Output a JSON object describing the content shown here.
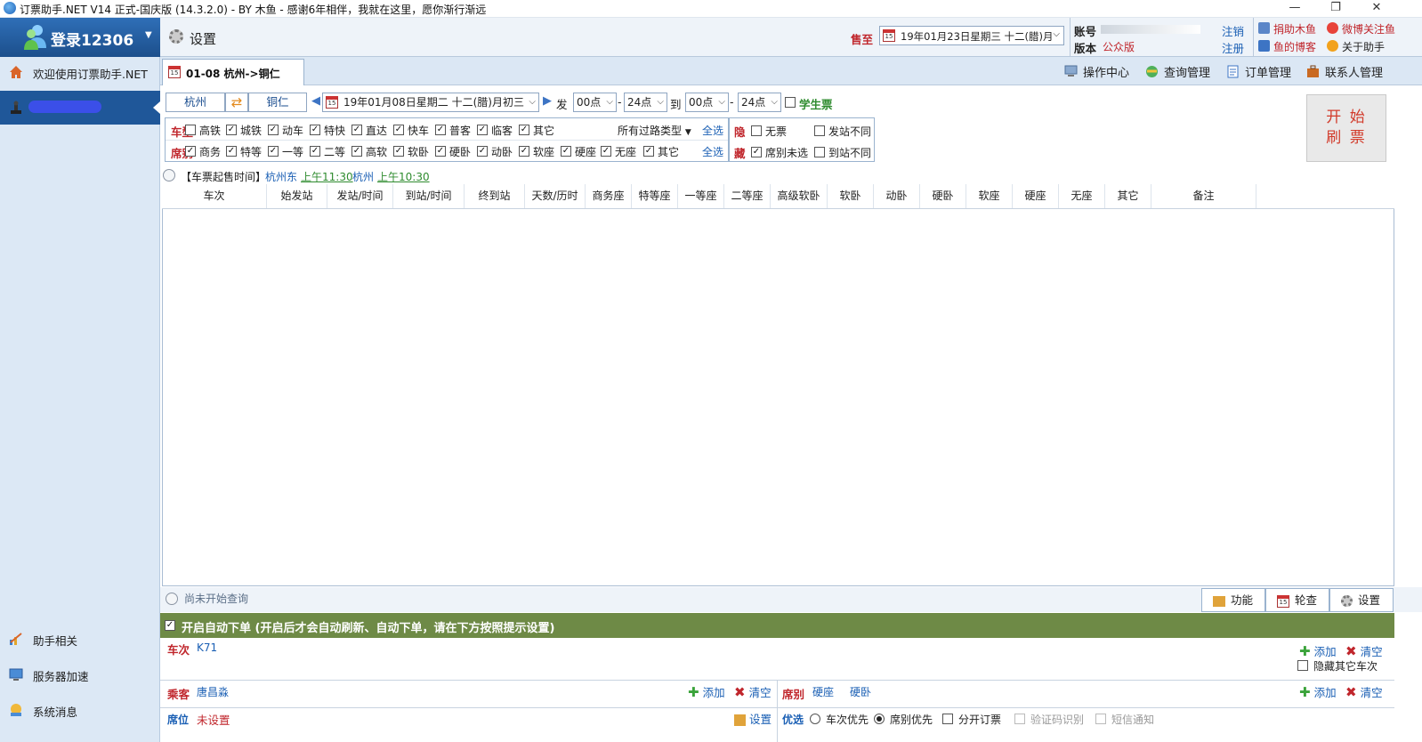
{
  "window": {
    "title": "订票助手.NET V14 正式-国庆版 (14.3.2.0) - BY 木鱼 - 感谢6年相伴，我就在这里，愿你渐行渐远",
    "minimize": "—",
    "restore": "❐",
    "close": "✕"
  },
  "sidebar": {
    "login_label": "登录12306",
    "items": [
      {
        "label": "欢迎使用订票助手.NET",
        "icon": "home-icon"
      },
      {
        "label": "助手相关",
        "icon": "chart-icon"
      },
      {
        "label": "服务器加速",
        "icon": "monitor-icon"
      },
      {
        "label": "系统消息",
        "icon": "message-icon"
      }
    ]
  },
  "toolbar": {
    "settings_label": "设置",
    "sale_label": "售至",
    "sale_date": "19年01月23日星期三 十二(腊)月",
    "account_label": "账号",
    "edition_label": "版本",
    "edition_value": "公众版",
    "logout": "注销",
    "register": "注册",
    "links": [
      "捐助木鱼",
      "微博关注鱼",
      "鱼的博客",
      "关于助手"
    ]
  },
  "tabs": {
    "active_tab": "01-08  杭州->铜仁",
    "menu": [
      "操作中心",
      "查询管理",
      "订单管理",
      "联系人管理"
    ]
  },
  "query": {
    "from": "杭州",
    "to": "铜仁",
    "date": "19年01月08日星期二 十二(腊)月初三",
    "depart_label": "发",
    "depart_from": "00点",
    "depart_to": "24点",
    "arrive_label": "到",
    "arrive_from": "00点",
    "arrive_to": "24点",
    "dash": "-",
    "student_label": "学生票"
  },
  "filter": {
    "type_label": "车型",
    "types": [
      {
        "label": "高铁",
        "checked": false
      },
      {
        "label": "城铁",
        "checked": true
      },
      {
        "label": "动车",
        "checked": true
      },
      {
        "label": "特快",
        "checked": true
      },
      {
        "label": "直达",
        "checked": true
      },
      {
        "label": "快车",
        "checked": true
      },
      {
        "label": "普客",
        "checked": true
      },
      {
        "label": "临客",
        "checked": true
      },
      {
        "label": "其它",
        "checked": true
      }
    ],
    "route_type": "所有过路类型",
    "select_all": "全选",
    "seat_label": "席别",
    "seats": [
      {
        "label": "商务",
        "checked": true
      },
      {
        "label": "特等",
        "checked": true
      },
      {
        "label": "一等",
        "checked": true
      },
      {
        "label": "二等",
        "checked": true
      },
      {
        "label": "高软",
        "checked": true
      },
      {
        "label": "软卧",
        "checked": true
      },
      {
        "label": "硬卧",
        "checked": true
      },
      {
        "label": "动卧",
        "checked": true
      },
      {
        "label": "软座",
        "checked": true
      },
      {
        "label": "硬座",
        "checked": true
      },
      {
        "label": "无座",
        "checked": true
      },
      {
        "label": "其它",
        "checked": true
      }
    ],
    "hide_label_1": "隐",
    "hide_label_2": "藏",
    "hide_options": [
      {
        "label": "无票",
        "checked": false
      },
      {
        "label": "发站不同",
        "checked": false
      },
      {
        "label": "席别未选",
        "checked": true
      },
      {
        "label": "到站不同",
        "checked": false
      }
    ]
  },
  "start_button": {
    "line1": "开 始",
    "line2": "刷 票"
  },
  "sale_time": {
    "prefix": "【车票起售时间】",
    "station1": "杭州东",
    "time1": "上午11:30",
    "station2": "杭州",
    "time2": "上午10:30"
  },
  "table": {
    "columns": [
      "车次",
      "始发站",
      "发站/时间",
      "到站/时间",
      "终到站",
      "天数/历时",
      "商务座",
      "特等座",
      "一等座",
      "二等座",
      "高级软卧",
      "软卧",
      "动卧",
      "硬卧",
      "软座",
      "硬座",
      "无座",
      "其它",
      "备注"
    ],
    "rows": []
  },
  "status": {
    "text": "尚未开始查询",
    "buttons": [
      "功能",
      "轮查",
      "设置"
    ]
  },
  "auto_order": {
    "enabled": true,
    "label": "开启自动下单 (开启后才会自动刷新、自动下单，请在下方按照提示设置)",
    "train_label": "车次",
    "train_value": "K71",
    "add": "添加",
    "clear": "清空",
    "hide_other_trains": "隐藏其它车次",
    "passenger_label": "乘客",
    "passenger_value": "唐昌淼",
    "seat_label": "席别",
    "seat_values": [
      "硬座",
      "硬卧"
    ],
    "position_label": "席位",
    "position_value": "未设置",
    "settings": "设置",
    "priority_label": "优选",
    "priority_train": "车次优先",
    "priority_seat": "席别优先",
    "split_order": "分开订票",
    "captcha": "验证码识别",
    "sms": "短信通知"
  },
  "colors": {
    "accent_blue": "#1f5799",
    "brand_red": "#c0262c",
    "auto_bar_green": "#6e8a46"
  }
}
